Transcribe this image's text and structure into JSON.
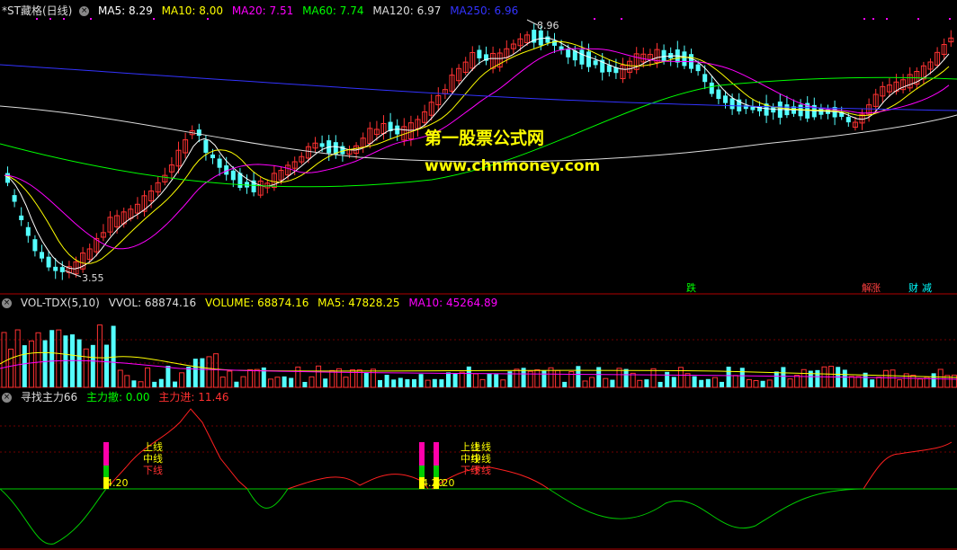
{
  "main_panel": {
    "title": "*ST藏格(日线)",
    "indicators": [
      {
        "label": "MA5: 8.29",
        "color": "#ffffff"
      },
      {
        "label": "MA10: 8.00",
        "color": "#ffff00"
      },
      {
        "label": "MA20: 7.51",
        "color": "#ff00ff"
      },
      {
        "label": "MA60: 7.74",
        "color": "#00ff00"
      },
      {
        "label": "MA120: 6.97",
        "color": "#dddddd"
      },
      {
        "label": "MA250: 6.96",
        "color": "#0000ff"
      }
    ],
    "high_label": "8.96",
    "low_label": "3.55",
    "watermark_title": "第一股票公式网",
    "watermark_url": "www.chnmoney.com",
    "event_tags": [
      {
        "text": "跌",
        "color": "#00ff00"
      },
      {
        "text": "解",
        "color": "#ff4040"
      },
      {
        "text": "涨",
        "color": "#ff4040"
      },
      {
        "text": "财",
        "color": "#00ffff"
      },
      {
        "text": "减",
        "color": "#00ffff"
      }
    ]
  },
  "volume_panel": {
    "title": "VOL-TDX(5,10)",
    "indicators": [
      {
        "label": "VVOL: 68874.16",
        "color": "#dddddd"
      },
      {
        "label": "VOLUME: 68874.16",
        "color": "#ffff00"
      },
      {
        "label": "MA5: 47828.25",
        "color": "#ffff00"
      },
      {
        "label": "MA10: 45264.89",
        "color": "#ff00ff"
      }
    ]
  },
  "signal_panel": {
    "title": "寻找主力66",
    "indicators": [
      {
        "label": "主力撤: 0.00",
        "color": "#00ff00"
      },
      {
        "label": "主力进: 11.46",
        "color": "#ff3030"
      }
    ],
    "labels": {
      "up": "上线",
      "mid": "中线",
      "down": "下线",
      "num": "4.20"
    },
    "labels_b": {
      "up": "上线",
      "mid": "中线",
      "down": "下线",
      "num": "4.20"
    },
    "labels_c": {
      "up": "上线",
      "mid": "中线",
      "down": "下线",
      "num": "4.20"
    }
  },
  "colors": {
    "up_candle": "#ff3232",
    "down_candle": "#54ffff",
    "grid": "#8b0000",
    "main_line": "#ff2020",
    "zero_line": "#00cc00"
  }
}
